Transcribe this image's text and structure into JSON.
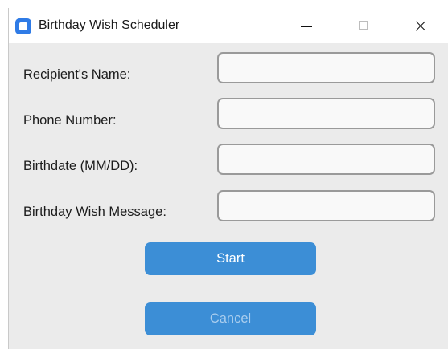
{
  "window": {
    "title": "Birthday Wish Scheduler",
    "icon": "app-window-icon",
    "controls": {
      "minimize": "minimize-icon",
      "maximize": "maximize-icon",
      "close": "close-icon"
    }
  },
  "form": {
    "fields": [
      {
        "label": "Recipient's Name:",
        "value": "",
        "placeholder": ""
      },
      {
        "label": "Phone Number:",
        "value": "",
        "placeholder": ""
      },
      {
        "label": "Birthdate (MM/DD):",
        "value": "",
        "placeholder": ""
      },
      {
        "label": "Birthday Wish Message:",
        "value": "",
        "placeholder": ""
      }
    ]
  },
  "buttons": {
    "start_label": "Start",
    "cancel_label": "Cancel"
  },
  "colors": {
    "accent": "#3c8ed6",
    "app_icon": "#2f7be6",
    "background": "#ebebeb"
  }
}
